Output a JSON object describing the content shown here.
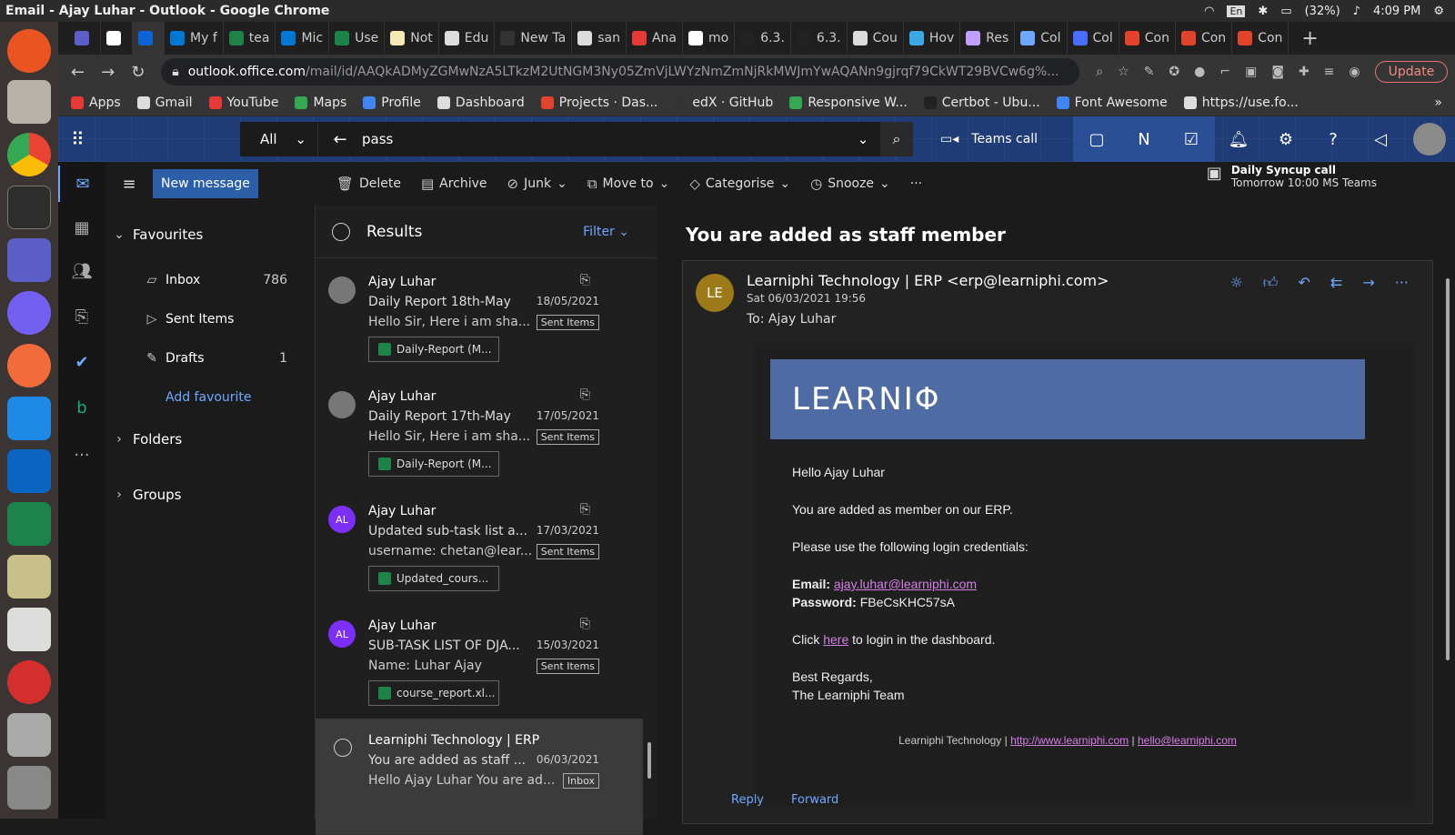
{
  "system": {
    "window_title": "Email - Ajay Luhar - Outlook - Google Chrome",
    "keyboard": "En",
    "battery": "(32%)",
    "clock": "4:09 PM"
  },
  "tabs": [
    {
      "label": "",
      "color": "#5b5fc7"
    },
    {
      "label": "",
      "color": "#fff"
    },
    {
      "label": "",
      "color": "#0a64d6",
      "active": true
    },
    {
      "label": "My f",
      "color": "#0078d4"
    },
    {
      "label": "tea",
      "color": "#1d8348"
    },
    {
      "label": "Mic",
      "color": "#0078d4"
    },
    {
      "label": "Use",
      "color": "#1d8348"
    },
    {
      "label": "Not",
      "color": "#f4e9b5"
    },
    {
      "label": "Edu",
      "color": "#ddd"
    },
    {
      "label": "New Ta",
      "color": "#333"
    },
    {
      "label": "san",
      "color": "#ddd"
    },
    {
      "label": "Ana",
      "color": "#e53935"
    },
    {
      "label": "mo",
      "color": "#fff"
    },
    {
      "label": "6.3.",
      "color": "#222"
    },
    {
      "label": "6.3.",
      "color": "#222"
    },
    {
      "label": "Cou",
      "color": "#ddd"
    },
    {
      "label": "Hov",
      "color": "#3da8e6"
    },
    {
      "label": "Res",
      "color": "#c0a0ff"
    },
    {
      "label": "Col",
      "color": "#6fa8ff"
    },
    {
      "label": "Col",
      "color": "#4a6cff"
    },
    {
      "label": "Con",
      "color": "#e2432a"
    },
    {
      "label": "Con",
      "color": "#e2432a"
    },
    {
      "label": "Con",
      "color": "#e2432a"
    }
  ],
  "address": {
    "host": "outlook.office.com",
    "path": "/mail/id/AAQkADMyZGMwNzA5LTkzM2UtNGM3Ny05ZmVjLWYzNmZmNjRkMWJmYwAQANn9gjrqf79CkWT29BVCw6g%...",
    "update": "Update"
  },
  "bookmarks": [
    {
      "label": "Apps",
      "color": "#e53935"
    },
    {
      "label": "Gmail",
      "color": "#ddd"
    },
    {
      "label": "YouTube",
      "color": "#e53935"
    },
    {
      "label": "Maps",
      "color": "#34a853"
    },
    {
      "label": "Profile",
      "color": "#4285f4"
    },
    {
      "label": "Dashboard",
      "color": "#ddd"
    },
    {
      "label": "Projects · Das...",
      "color": "#e2432a"
    },
    {
      "label": "edX · GitHub",
      "color": "#333"
    },
    {
      "label": "Responsive W...",
      "color": "#34a853"
    },
    {
      "label": "Certbot - Ubu...",
      "color": "#222"
    },
    {
      "label": "Font Awesome",
      "color": "#4285f4"
    },
    {
      "label": "https://use.fo...",
      "color": "#ddd"
    }
  ],
  "header": {
    "scope": "All",
    "search_term": "pass",
    "teams_call": "Teams call"
  },
  "toolbar": {
    "new_message": "New message",
    "delete": "Delete",
    "archive": "Archive",
    "junk": "Junk",
    "move_to": "Move to",
    "categorise": "Categorise",
    "snooze": "Snooze",
    "more": "···"
  },
  "calendar": {
    "title": "Daily Syncup call",
    "detail": "Tomorrow 10:00 MS Teams"
  },
  "folders": {
    "favourites": "Favourites",
    "inbox": "Inbox",
    "inbox_count": "786",
    "sent": "Sent Items",
    "drafts": "Drafts",
    "drafts_count": "1",
    "add_fav": "Add favourite",
    "folders": "Folders",
    "groups": "Groups"
  },
  "list": {
    "title": "Results",
    "filter": "Filter",
    "items": [
      {
        "from": "Ajay Luhar",
        "subject": "Daily Report 18th-May",
        "preview": "Hello Sir, Here i am sha...",
        "date": "18/05/2021",
        "folder": "Sent Items",
        "attachment": "Daily-Report (M...",
        "initials": ""
      },
      {
        "from": "Ajay Luhar",
        "subject": "Daily Report 17th-May",
        "preview": "Hello Sir, Here i am sha...",
        "date": "17/05/2021",
        "folder": "Sent Items",
        "attachment": "Daily-Report (M...",
        "initials": ""
      },
      {
        "from": "Ajay Luhar",
        "subject": "Updated sub-task list a...",
        "preview": "username: chetan@lear...",
        "date": "17/03/2021",
        "folder": "Sent Items",
        "attachment": "Updated_cours...",
        "initials": "AL"
      },
      {
        "from": "Ajay Luhar",
        "subject": "SUB-TASK LIST OF DJA...",
        "preview": "Name: Luhar Ajay",
        "date": "15/03/2021",
        "folder": "Sent Items",
        "attachment": "course_report.xl...",
        "initials": "AL"
      },
      {
        "from": "Learniphi Technology | ERP",
        "subject": "You are added as staff ...",
        "preview": "Hello Ajay Luhar You are ad...",
        "date": "06/03/2021",
        "folder": "Inbox",
        "attachment": "",
        "initials": ""
      }
    ]
  },
  "reading": {
    "title": "You are added as staff member",
    "avatar": "LE",
    "sender": "Learniphi Technology | ERP <erp@learniphi.com>",
    "sent": "Sat 06/03/2021 19:56",
    "to_label": "To:",
    "to": "Ajay Luhar",
    "logo": "LEARNIΦ",
    "greeting": "Hello Ajay Luhar",
    "line1": "You are added as member on our ERP.",
    "line2": "Please use the following login credentials:",
    "email_label": "Email:",
    "email": "ajay.luhar@learniphi.com",
    "password_label": "Password:",
    "password": "FBeCsKHC57sA",
    "click": "Click",
    "here": "here",
    "click_rest": "to login in the dashboard.",
    "regards": "Best Regards,",
    "team": "The Learniphi Team",
    "footer_company": "Learniphi Technology |",
    "footer_url": "http://www.learniphi.com",
    "footer_sep": "|",
    "footer_email": "hello@learniphi.com",
    "reply": "Reply",
    "forward": "Forward"
  }
}
